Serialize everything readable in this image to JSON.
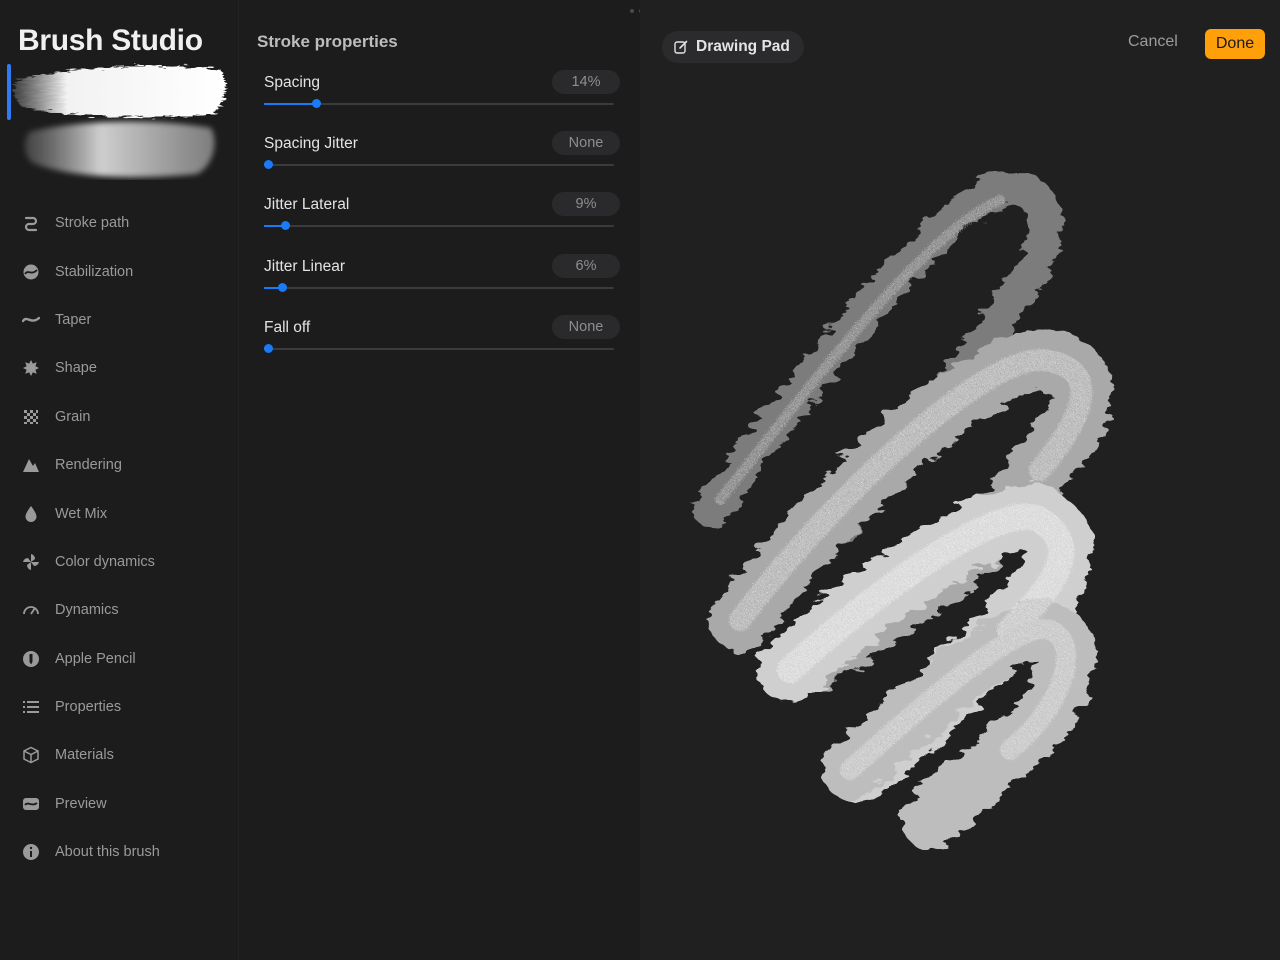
{
  "app": {
    "title": "Brush Studio"
  },
  "sidebar": {
    "items": [
      {
        "label": "Stroke path",
        "icon": "stroke-path-icon",
        "active": true
      },
      {
        "label": "Stabilization",
        "icon": "stabilization-icon",
        "active": false
      },
      {
        "label": "Taper",
        "icon": "taper-icon",
        "active": false
      },
      {
        "label": "Shape",
        "icon": "shape-icon",
        "active": false
      },
      {
        "label": "Grain",
        "icon": "grain-icon",
        "active": false
      },
      {
        "label": "Rendering",
        "icon": "rendering-icon",
        "active": false
      },
      {
        "label": "Wet Mix",
        "icon": "wet-mix-icon",
        "active": false
      },
      {
        "label": "Color dynamics",
        "icon": "color-dynamics-icon",
        "active": false
      },
      {
        "label": "Dynamics",
        "icon": "dynamics-icon",
        "active": false
      },
      {
        "label": "Apple Pencil",
        "icon": "apple-pencil-icon",
        "active": false
      },
      {
        "label": "Properties",
        "icon": "properties-icon",
        "active": false
      },
      {
        "label": "Materials",
        "icon": "materials-icon",
        "active": false
      },
      {
        "label": "Preview",
        "icon": "preview-icon",
        "active": false
      },
      {
        "label": "About this brush",
        "icon": "info-icon",
        "active": false
      }
    ]
  },
  "settings": {
    "title": "Stroke properties",
    "controls": [
      {
        "label": "Spacing",
        "value": "14%",
        "level": 0.14
      },
      {
        "label": "Spacing Jitter",
        "value": "None",
        "level": 0.0
      },
      {
        "label": "Jitter Lateral",
        "value": "9%",
        "level": 0.05
      },
      {
        "label": "Jitter Linear",
        "value": "6%",
        "level": 0.04
      },
      {
        "label": "Fall off",
        "value": "None",
        "level": 0.0
      }
    ]
  },
  "pad": {
    "title": "Drawing Pad",
    "cancel_label": "Cancel",
    "done_label": "Done"
  },
  "colors": {
    "accent": "#1a7bf8",
    "done": "#ff9f0a",
    "background": "#1d1d1e"
  }
}
